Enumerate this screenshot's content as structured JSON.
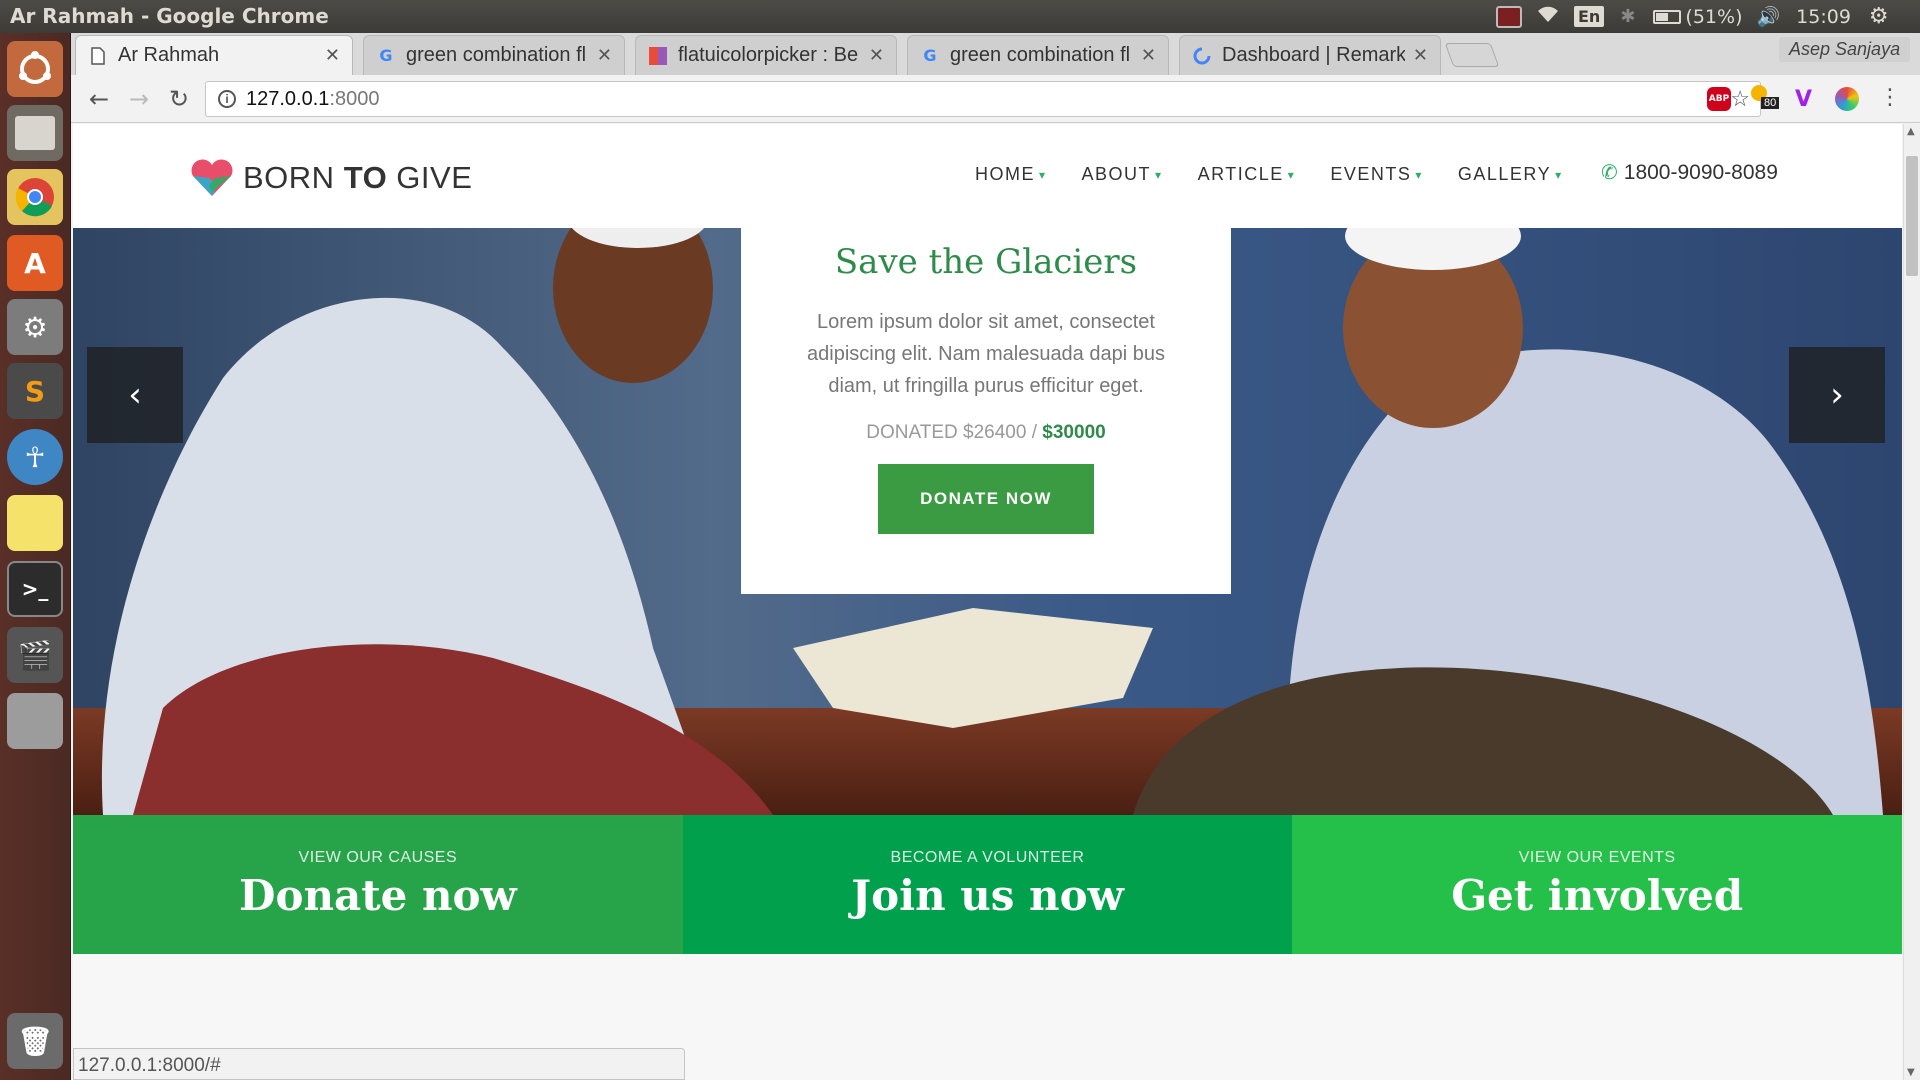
{
  "os": {
    "window_title": "Ar Rahmah - Google Chrome",
    "keyboard_layout": "En",
    "battery": "(51%)",
    "clock": "15:09",
    "user_name": "Asep Sanjaya"
  },
  "launcher": {
    "items": [
      "ubuntu-dash-icon",
      "files-icon",
      "chrome-icon",
      "software-center-icon",
      "system-settings-icon",
      "sublime-text-icon",
      "accessibility-icon",
      "sticky-notes-icon",
      "terminal-icon",
      "video-editor-icon",
      "disk-icon",
      "trash-icon"
    ]
  },
  "tabs": [
    {
      "title": "Ar Rahmah",
      "favicon": "page-icon",
      "active": true
    },
    {
      "title": "green combination fl",
      "favicon": "google-icon",
      "active": false
    },
    {
      "title": "flatuicolorpicker : Be",
      "favicon": "flatui-icon",
      "active": false
    },
    {
      "title": "green combination fl",
      "favicon": "google-icon",
      "active": false
    },
    {
      "title": "Dashboard | Remark",
      "favicon": "remark-icon",
      "active": false
    }
  ],
  "toolbar": {
    "url_host": "127.0.0.1",
    "url_port": ":8000",
    "weather_badge": "80",
    "abp_label": "ABP"
  },
  "site": {
    "logo_part1": "BORN ",
    "logo_part2": "TO",
    "logo_part3": " GIVE",
    "nav": [
      "HOME",
      "ABOUT",
      "ARTICLE",
      "EVENTS",
      "GALLERY"
    ],
    "phone": "1800-9090-8089",
    "accent_color": "#2bae66"
  },
  "hero": {
    "cause_title": "Save the Glaciers",
    "cause_description": "Lorem ipsum dolor sit amet, consectet adipiscing elit. Nam malesuada dapi bus diam, ut fringilla purus efficitur eget.",
    "donated_label": "DONATED $26400 / ",
    "goal_amount": "$30000",
    "donate_button": "DONATE NOW",
    "prev_icon": "chevron-left-icon",
    "next_icon": "chevron-right-icon"
  },
  "features": [
    {
      "sub": "VIEW OUR CAUSES",
      "main": "Donate now",
      "color": "#27a44a"
    },
    {
      "sub": "BECOME A VOLUNTEER",
      "main": "Join us now",
      "color": "#00a04c"
    },
    {
      "sub": "VIEW OUR EVENTS",
      "main": "Get involved",
      "color": "#25c04a"
    }
  ],
  "status_bar": "127.0.0.1:8000/#"
}
